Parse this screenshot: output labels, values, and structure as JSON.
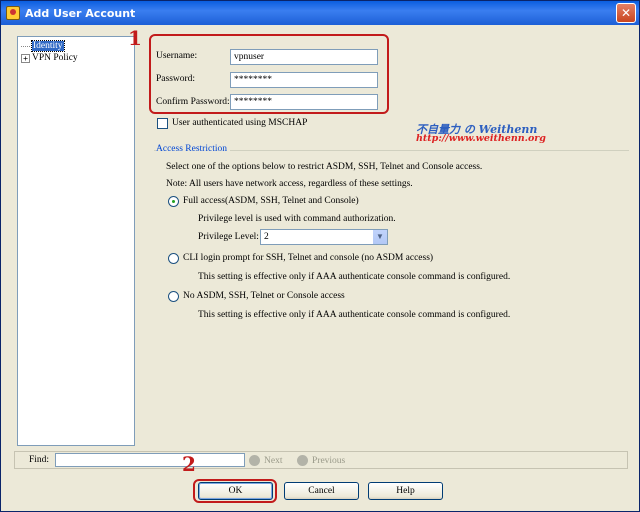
{
  "window": {
    "title": "Add User Account",
    "close_glyph": "✕"
  },
  "tree": {
    "items": [
      {
        "label": "Identity",
        "selected": true
      },
      {
        "label": "VPN Policy",
        "expander": "+"
      }
    ]
  },
  "credentials": {
    "username_label": "Username:",
    "username_value": "vpnuser",
    "password_label": "Password:",
    "password_value": "********",
    "confirm_label": "Confirm Password:",
    "confirm_value": "********"
  },
  "mschap_label": "User authenticated using MSCHAP",
  "access_restriction": {
    "title": "Access Restriction",
    "intro": "Select one of the options below to restrict ASDM, SSH, Telnet and Console access.",
    "note": "Note: All users have network access, regardless of these settings.",
    "options": [
      {
        "label": "Full access(ASDM, SSH, Telnet and Console)",
        "checked": true
      },
      {
        "label": "CLI login prompt for SSH, Telnet and console (no ASDM access)",
        "checked": false
      },
      {
        "label": "No ASDM, SSH, Telnet or Console access",
        "checked": false
      }
    ],
    "full_access_desc": "Privilege level is used with command authorization.",
    "privilege_label": "Privilege Level:",
    "privilege_value": "2",
    "cli_desc": "This setting is effective only if AAA authenticate console command is configured.",
    "none_desc": "This setting is effective only if AAA authenticate console command is configured."
  },
  "watermark": {
    "line1": "不自量力 の Weithenn",
    "line2": "http://www.weithenn.org"
  },
  "annotations": {
    "marker1": "1",
    "marker2": "2"
  },
  "find_bar": {
    "label": "Find:",
    "next_label": "Next",
    "previous_label": "Previous"
  },
  "buttons": {
    "ok": "OK",
    "cancel": "Cancel",
    "help": "Help"
  },
  "colors": {
    "highlight": "#c21b1b",
    "section_title": "#0046d5",
    "titlebar": "#0a5ee0"
  }
}
